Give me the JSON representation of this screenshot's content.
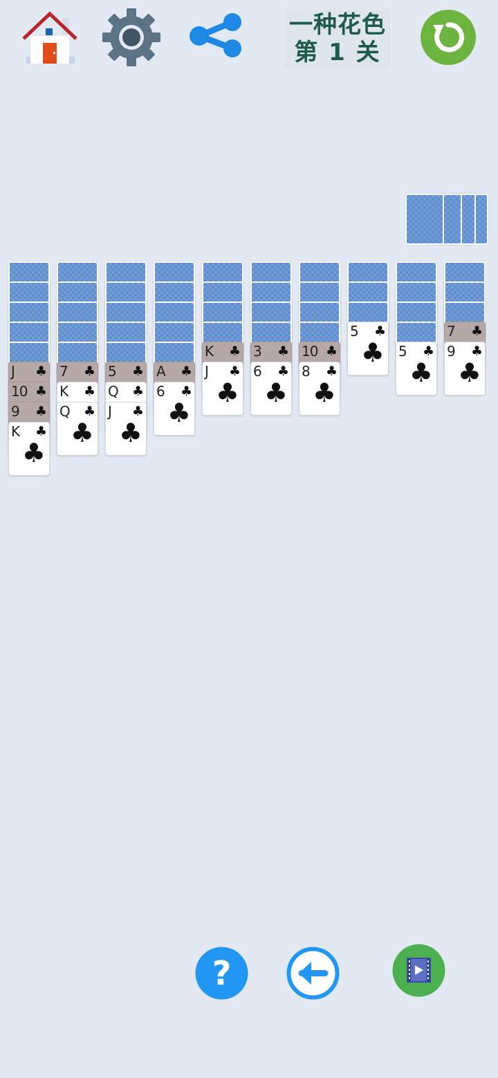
{
  "header": {
    "title_line1": "一种花色",
    "title_line2": "第 1 关",
    "icons": {
      "home": "home-icon",
      "settings": "gear-icon",
      "share": "share-icon",
      "restart": "restart-icon"
    }
  },
  "colors": {
    "background": "#e3e9f2",
    "card_back": "#5f8fcf",
    "card_face": "#ffffff",
    "card_shaded": "#b5a8a6",
    "restart_button": "#6db33f",
    "help_button": "#2196f3",
    "video_button": "#4caf50"
  },
  "suit_symbol": "♣",
  "tableau": [
    {
      "down": 5,
      "up": [
        {
          "rank": "J",
          "shaded": true
        },
        {
          "rank": "10",
          "shaded": true
        },
        {
          "rank": "9",
          "shaded": true
        },
        {
          "rank": "K",
          "shaded": false
        }
      ]
    },
    {
      "down": 5,
      "up": [
        {
          "rank": "7",
          "shaded": true
        },
        {
          "rank": "K",
          "shaded": false
        },
        {
          "rank": "Q",
          "shaded": false
        }
      ]
    },
    {
      "down": 5,
      "up": [
        {
          "rank": "5",
          "shaded": true
        },
        {
          "rank": "Q",
          "shaded": false
        },
        {
          "rank": "J",
          "shaded": false
        }
      ]
    },
    {
      "down": 5,
      "up": [
        {
          "rank": "A",
          "shaded": true
        },
        {
          "rank": "6",
          "shaded": false
        }
      ]
    },
    {
      "down": 4,
      "up": [
        {
          "rank": "K",
          "shaded": true
        },
        {
          "rank": "J",
          "shaded": false
        }
      ]
    },
    {
      "down": 4,
      "up": [
        {
          "rank": "3",
          "shaded": true
        },
        {
          "rank": "6",
          "shaded": false
        }
      ]
    },
    {
      "down": 4,
      "up": [
        {
          "rank": "10",
          "shaded": true
        },
        {
          "rank": "8",
          "shaded": false
        }
      ]
    },
    {
      "down": 3,
      "up": [
        {
          "rank": "5",
          "shaded": false
        }
      ]
    },
    {
      "down": 4,
      "up": [
        {
          "rank": "5",
          "shaded": false
        }
      ]
    },
    {
      "down": 3,
      "up": [
        {
          "rank": "7",
          "shaded": true
        },
        {
          "rank": "9",
          "shaded": false
        }
      ]
    }
  ],
  "stock": {
    "piles": 4
  },
  "footer": {
    "icons": {
      "help": "help-icon",
      "undo": "undo-icon",
      "video": "video-hint-icon"
    }
  }
}
